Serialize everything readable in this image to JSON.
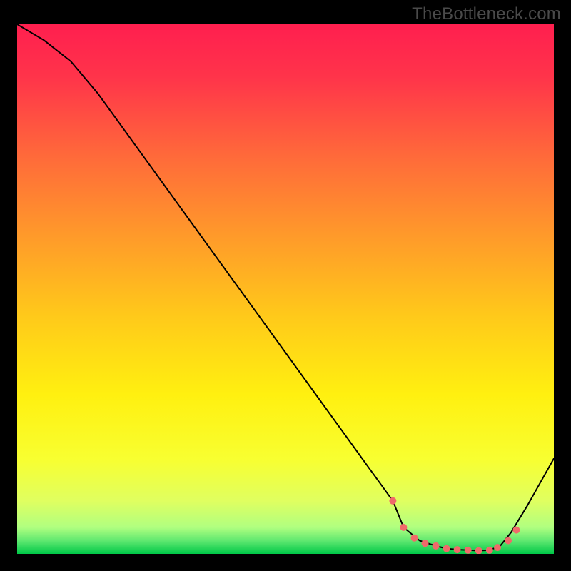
{
  "watermark": "TheBottleneck.com",
  "chart_data": {
    "type": "line",
    "title": "",
    "xlabel": "",
    "ylabel": "",
    "xlim": [
      0,
      100
    ],
    "ylim": [
      0,
      100
    ],
    "grid": false,
    "legend": false,
    "series": [
      {
        "name": "curve",
        "x": [
          0,
          5,
          10,
          15,
          20,
          25,
          30,
          35,
          40,
          45,
          50,
          55,
          60,
          65,
          70,
          72,
          75,
          78,
          80,
          82,
          84,
          86,
          88,
          90,
          92,
          95,
          100
        ],
        "values": [
          100,
          97,
          93,
          87,
          80,
          73,
          66,
          59,
          52,
          45,
          38,
          31,
          24,
          17,
          10,
          5,
          2.5,
          1.5,
          1.0,
          0.8,
          0.7,
          0.6,
          0.7,
          1.5,
          4.0,
          9.0,
          18
        ],
        "color": "#000000"
      }
    ],
    "markers": {
      "name": "highlight-points",
      "color": "#f06a6a",
      "radius": 5,
      "x": [
        70,
        72,
        74,
        76,
        78,
        80,
        82,
        84,
        86,
        88,
        89.5,
        91.5,
        93
      ],
      "values": [
        10,
        5,
        3,
        2,
        1.5,
        1.0,
        0.8,
        0.7,
        0.6,
        0.7,
        1.2,
        2.5,
        4.5
      ]
    },
    "background_gradient": {
      "orientation": "vertical",
      "stops": [
        {
          "offset": 0.0,
          "color": "#ff1f4f"
        },
        {
          "offset": 0.4,
          "color": "#ff9a2a"
        },
        {
          "offset": 0.7,
          "color": "#fff010"
        },
        {
          "offset": 0.95,
          "color": "#60e870"
        },
        {
          "offset": 1.0,
          "color": "#00c848"
        }
      ]
    }
  }
}
